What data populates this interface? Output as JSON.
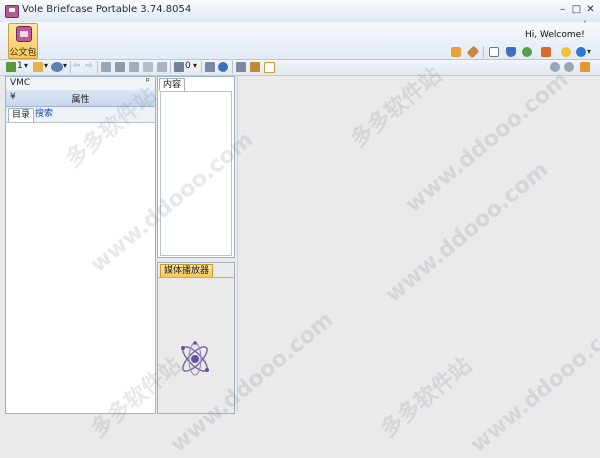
{
  "window": {
    "title": "Vole Briefcase Portable  3.74.8054",
    "minimize_glyph": "–",
    "maximize_glyph": "□",
    "close_glyph": "✕"
  },
  "ribbon": {
    "tab_label": "公文包",
    "welcome": "Hi, Welcome!",
    "collapse_glyph": "˄",
    "icons": [
      "paint-icon",
      "tools-icon",
      "book-icon",
      "shield-icon",
      "globe-icon",
      "translate-icon",
      "lightbulb-icon",
      "info-icon"
    ]
  },
  "toolbar": {
    "count_1": "1",
    "count_0": "0",
    "dropdown_glyph": "▾",
    "nav_back_glyph": "⇦",
    "nav_forward_glyph": "⇨"
  },
  "left_panel": {
    "vmc_label": "VMC",
    "pin_glyph": "ᵖ",
    "props_collapse_glyph": "¥",
    "props_label": "属性",
    "tabs": [
      {
        "label": "目录"
      },
      {
        "label": "搜索"
      }
    ]
  },
  "content_panel": {
    "tab_label": "内容"
  },
  "media_panel": {
    "tab_label": "媒体播放器"
  },
  "watermark": {
    "cn": "多多软件站",
    "url": "www.ddooo.com"
  }
}
